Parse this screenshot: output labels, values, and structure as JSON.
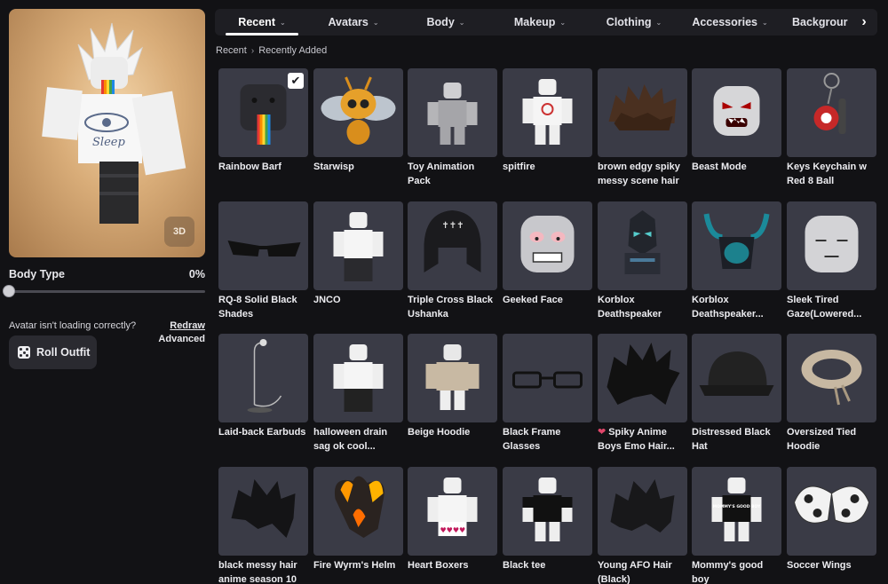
{
  "preview": {
    "view_toggle": "3D",
    "shirt_text": "Sleep"
  },
  "body_type": {
    "label": "Body Type",
    "value": "0%",
    "fraction": 0
  },
  "loading": {
    "text": "Avatar isn't loading correctly?",
    "redraw": "Redraw",
    "advanced": "Advanced"
  },
  "roll_outfit": {
    "label": "Roll Outfit"
  },
  "tabs": [
    {
      "label": "Recent",
      "active": true
    },
    {
      "label": "Avatars"
    },
    {
      "label": "Body"
    },
    {
      "label": "Makeup"
    },
    {
      "label": "Clothing"
    },
    {
      "label": "Accessories"
    },
    {
      "label": "Backgrour"
    }
  ],
  "breadcrumb": {
    "root": "Recent",
    "current": "Recently Added"
  },
  "items": [
    {
      "name": "Rainbow Barf",
      "icon": "rainbow-barf-icon",
      "selected": true
    },
    {
      "name": "Starwisp",
      "icon": "starwisp-icon"
    },
    {
      "name": "Toy Animation Pack",
      "icon": "toy-animation-icon"
    },
    {
      "name": "spitfire",
      "icon": "spitfire-icon"
    },
    {
      "name": "brown edgy spiky messy scene hair",
      "icon": "brown-hair-icon"
    },
    {
      "name": "Beast Mode",
      "icon": "beast-mode-icon"
    },
    {
      "name": "Keys Keychain w Red 8 Ball",
      "icon": "keychain-icon"
    },
    {
      "name": "RQ-8 Solid Black Shades",
      "icon": "shades-icon"
    },
    {
      "name": "JNCO",
      "icon": "jnco-icon"
    },
    {
      "name": "Triple Cross Black Ushanka",
      "icon": "ushanka-icon"
    },
    {
      "name": "Geeked Face",
      "icon": "geeked-face-icon"
    },
    {
      "name": "Korblox Deathspeaker",
      "icon": "korblox-icon"
    },
    {
      "name": "Korblox Deathspeaker...",
      "icon": "korblox-helm-icon"
    },
    {
      "name": "Sleek Tired Gaze(Lowered...",
      "icon": "tired-face-icon"
    },
    {
      "name": "Laid-back Earbuds",
      "icon": "earbuds-icon"
    },
    {
      "name": "halloween drain sag ok cool...",
      "icon": "drain-sag-icon"
    },
    {
      "name": "Beige Hoodie",
      "icon": "beige-hoodie-icon"
    },
    {
      "name": "Black Frame Glasses",
      "icon": "glasses-icon"
    },
    {
      "name": "Spiky Anime Boys Emo Hair...",
      "icon": "anime-hair-icon",
      "heart": true
    },
    {
      "name": "Distressed Black Hat",
      "icon": "black-hat-icon"
    },
    {
      "name": "Oversized Tied Hoodie",
      "icon": "tied-hoodie-icon"
    },
    {
      "name": "black messy hair anime season 10",
      "icon": "black-messy-hair-icon"
    },
    {
      "name": "Fire Wyrm's Helm",
      "icon": "fire-helm-icon"
    },
    {
      "name": "Heart Boxers",
      "icon": "heart-boxers-icon"
    },
    {
      "name": "Black tee",
      "icon": "black-tee-icon"
    },
    {
      "name": "Young AFO Hair (Black)",
      "icon": "afo-hair-icon"
    },
    {
      "name": "Mommy's good boy",
      "icon": "mommy-shirt-icon",
      "shirt_text": "MOMMY'S GOOD BOY"
    },
    {
      "name": "Soccer Wings",
      "icon": "soccer-wings-icon"
    }
  ]
}
